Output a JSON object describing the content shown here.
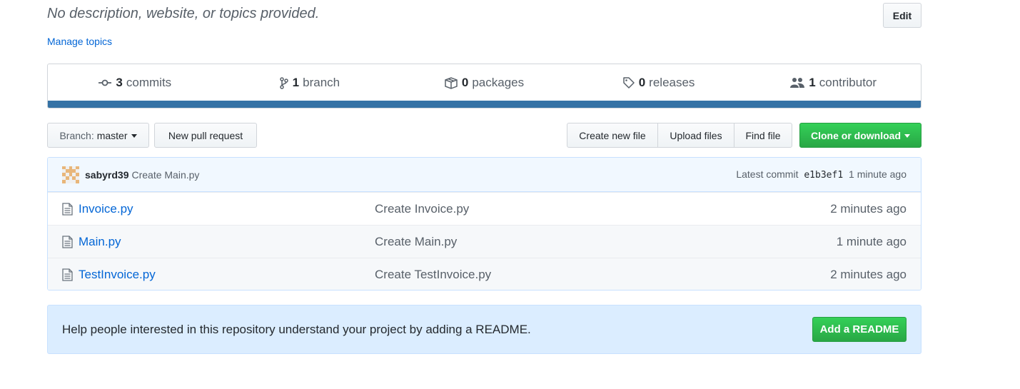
{
  "header": {
    "description": "No description, website, or topics provided.",
    "edit_label": "Edit",
    "manage_topics": "Manage topics"
  },
  "summary": {
    "commits": {
      "count": "3",
      "label": "commits",
      "icon": "commit-icon"
    },
    "branches": {
      "count": "1",
      "label": "branch",
      "icon": "branch-icon"
    },
    "packages": {
      "count": "0",
      "label": "packages",
      "icon": "package-icon"
    },
    "releases": {
      "count": "0",
      "label": "releases",
      "icon": "tag-icon"
    },
    "contributors": {
      "count": "1",
      "label": "contributor",
      "icon": "people-icon"
    },
    "language_color": "#3572A5"
  },
  "toolbar": {
    "branch_prefix": "Branch:",
    "branch_name": "master",
    "new_pull_request": "New pull request",
    "create_new_file": "Create new file",
    "upload_files": "Upload files",
    "find_file": "Find file",
    "clone_or_download": "Clone or download"
  },
  "latest_commit": {
    "author": "sabyrd39",
    "message": "Create Main.py",
    "prefix": "Latest commit",
    "sha": "e1b3ef1",
    "age": "1 minute ago"
  },
  "files": [
    {
      "name": "Invoice.py",
      "message": "Create Invoice.py",
      "age": "2 minutes ago"
    },
    {
      "name": "Main.py",
      "message": "Create Main.py",
      "age": "1 minute ago"
    },
    {
      "name": "TestInvoice.py",
      "message": "Create TestInvoice.py",
      "age": "2 minutes ago"
    }
  ],
  "readme": {
    "text": "Help people interested in this repository understand your project by adding a README.",
    "button": "Add a README"
  },
  "colors": {
    "link": "#0366d6",
    "primary_button": "#28a745",
    "readme_banner": "#dbedff"
  }
}
